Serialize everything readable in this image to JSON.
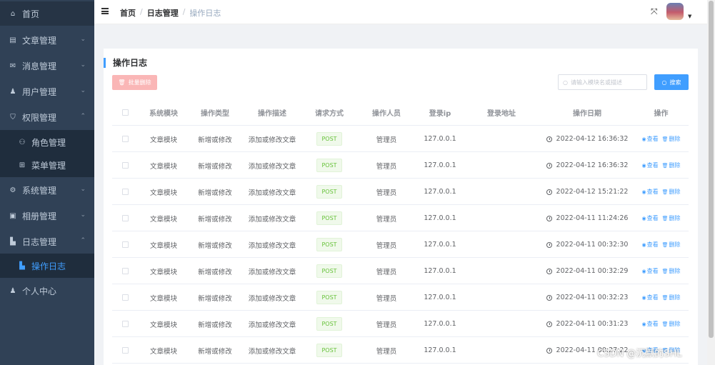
{
  "sidebar": {
    "items": [
      {
        "label": "首页",
        "icon": "home-icon",
        "arrow": ""
      },
      {
        "label": "文章管理",
        "icon": "document-icon",
        "arrow": "⌄"
      },
      {
        "label": "消息管理",
        "icon": "mail-icon",
        "arrow": "⌄"
      },
      {
        "label": "用户管理",
        "icon": "user-icon",
        "arrow": "⌄"
      },
      {
        "label": "权限管理",
        "icon": "shield-icon",
        "arrow": "⌃"
      },
      {
        "label": "角色管理",
        "icon": "users-icon",
        "arrow": ""
      },
      {
        "label": "菜单管理",
        "icon": "menu-grid-icon",
        "arrow": ""
      },
      {
        "label": "系统管理",
        "icon": "gear-icon",
        "arrow": "⌄"
      },
      {
        "label": "相册管理",
        "icon": "image-icon",
        "arrow": "⌄"
      },
      {
        "label": "日志管理",
        "icon": "log-icon",
        "arrow": "⌃"
      },
      {
        "label": "操作日志",
        "icon": "log-file-icon",
        "arrow": ""
      },
      {
        "label": "个人中心",
        "icon": "person-icon",
        "arrow": ""
      }
    ],
    "active_color": "#409eff",
    "bg_color": "#304156"
  },
  "navbar": {
    "breadcrumb": [
      "首页",
      "日志管理",
      "操作日志"
    ],
    "separator": "/"
  },
  "card": {
    "title": "操作日志",
    "batch_delete_label": "批量删除",
    "search_placeholder": "请输入模块名或描述",
    "search_button_label": "搜索"
  },
  "table": {
    "headers": [
      "系统模块",
      "操作类型",
      "操作描述",
      "请求方式",
      "操作人员",
      "登录ip",
      "登录地址",
      "操作日期",
      "操作"
    ],
    "view_label": "查看",
    "delete_label": "删除",
    "rows": [
      {
        "module": "文章模块",
        "type": "新增或修改",
        "desc": "添加或修改文章",
        "method": "POST",
        "user": "管理员",
        "ip": "127.0.0.1",
        "addr": "",
        "date": "2022-04-12 16:36:32"
      },
      {
        "module": "文章模块",
        "type": "新增或修改",
        "desc": "添加或修改文章",
        "method": "POST",
        "user": "管理员",
        "ip": "127.0.0.1",
        "addr": "",
        "date": "2022-04-12 16:36:32"
      },
      {
        "module": "文章模块",
        "type": "新增或修改",
        "desc": "添加或修改文章",
        "method": "POST",
        "user": "管理员",
        "ip": "127.0.0.1",
        "addr": "",
        "date": "2022-04-12 15:21:22"
      },
      {
        "module": "文章模块",
        "type": "新增或修改",
        "desc": "添加或修改文章",
        "method": "POST",
        "user": "管理员",
        "ip": "127.0.0.1",
        "addr": "",
        "date": "2022-04-11 11:24:26"
      },
      {
        "module": "文章模块",
        "type": "新增或修改",
        "desc": "添加或修改文章",
        "method": "POST",
        "user": "管理员",
        "ip": "127.0.0.1",
        "addr": "",
        "date": "2022-04-11 00:32:30"
      },
      {
        "module": "文章模块",
        "type": "新增或修改",
        "desc": "添加或修改文章",
        "method": "POST",
        "user": "管理员",
        "ip": "127.0.0.1",
        "addr": "",
        "date": "2022-04-11 00:32:29"
      },
      {
        "module": "文章模块",
        "type": "新增或修改",
        "desc": "添加或修改文章",
        "method": "POST",
        "user": "管理员",
        "ip": "127.0.0.1",
        "addr": "",
        "date": "2022-04-11 00:32:23"
      },
      {
        "module": "文章模块",
        "type": "新增或修改",
        "desc": "添加或修改文章",
        "method": "POST",
        "user": "管理员",
        "ip": "127.0.0.1",
        "addr": "",
        "date": "2022-04-11 00:31:23"
      },
      {
        "module": "文章模块",
        "type": "新增或修改",
        "desc": "添加或修改文章",
        "method": "POST",
        "user": "管理员",
        "ip": "127.0.0.1",
        "addr": "",
        "date": "2022-04-11 00:27:22"
      }
    ]
  },
  "watermark": "CSDN @沉默的SHL"
}
